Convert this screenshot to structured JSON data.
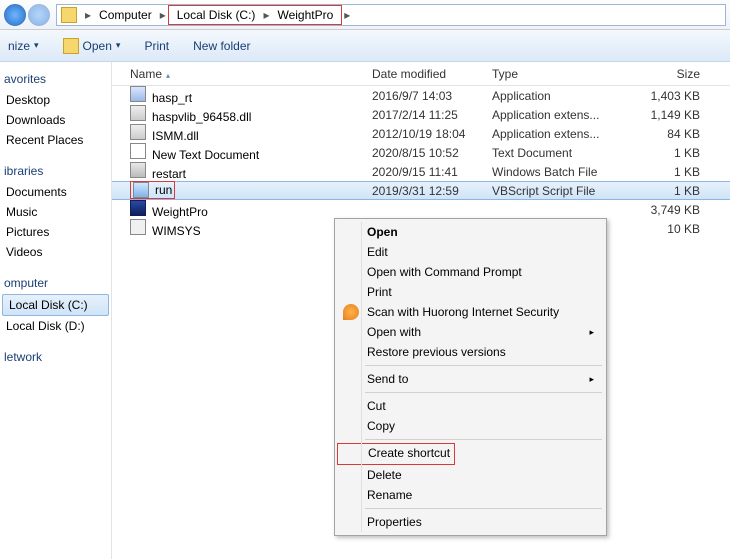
{
  "breadcrumb": {
    "root": "Computer",
    "drive": "Local Disk (C:)",
    "folder": "WeightPro"
  },
  "toolbar": {
    "organize": "nize",
    "open": "Open",
    "print": "Print",
    "newfolder": "New folder"
  },
  "sidebar": {
    "favorites": "avorites",
    "fav_items": [
      "Desktop",
      "Downloads",
      "Recent Places"
    ],
    "libraries": "ibraries",
    "lib_items": [
      "Documents",
      "Music",
      "Pictures",
      "Videos"
    ],
    "computer": "omputer",
    "drives": [
      "Local Disk (C:)",
      "Local Disk (D:)"
    ],
    "network": "letwork"
  },
  "columns": {
    "name": "Name",
    "date": "Date modified",
    "type": "Type",
    "size": "Size"
  },
  "files": [
    {
      "name": "hasp_rt",
      "date": "2016/9/7 14:03",
      "type": "Application",
      "size": "1,403 KB",
      "ic": "ic-app"
    },
    {
      "name": "haspvlib_96458.dll",
      "date": "2017/2/14 11:25",
      "type": "Application extens...",
      "size": "1,149 KB",
      "ic": "ic-dll"
    },
    {
      "name": "ISMM.dll",
      "date": "2012/10/19 18:04",
      "type": "Application extens...",
      "size": "84 KB",
      "ic": "ic-dll"
    },
    {
      "name": "New Text Document",
      "date": "2020/8/15 10:52",
      "type": "Text Document",
      "size": "1 KB",
      "ic": "ic-txt"
    },
    {
      "name": "restart",
      "date": "2020/9/15 11:41",
      "type": "Windows Batch File",
      "size": "1 KB",
      "ic": "ic-bat"
    },
    {
      "name": "run",
      "date": "2019/3/31 12:59",
      "type": "VBScript Script File",
      "size": "1 KB",
      "ic": "ic-vbs",
      "sel": true,
      "boxed": true
    },
    {
      "name": "WeightPro",
      "date": "",
      "type": "",
      "size": "3,749 KB",
      "ic": "ic-wp"
    },
    {
      "name": "WIMSYS",
      "date": "",
      "type": "",
      "size": "10 KB",
      "ic": "ic-sys"
    }
  ],
  "ctx": {
    "open": "Open",
    "edit": "Edit",
    "owcp": "Open with Command Prompt",
    "print": "Print",
    "huorong": "Scan with Huorong Internet Security",
    "openwith": "Open with",
    "restore": "Restore previous versions",
    "sendto": "Send to",
    "cut": "Cut",
    "copy": "Copy",
    "shortcut": "Create shortcut",
    "delete": "Delete",
    "rename": "Rename",
    "props": "Properties"
  }
}
